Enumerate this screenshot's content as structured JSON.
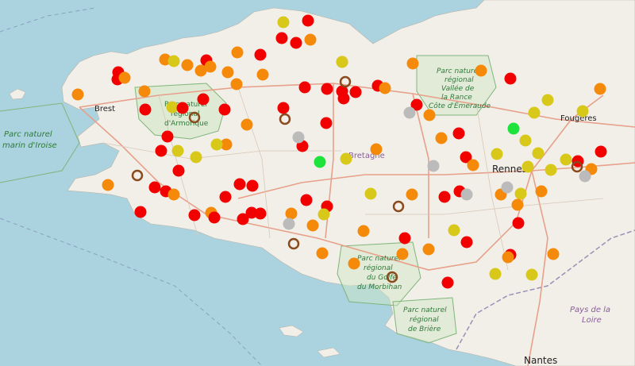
{
  "map": {
    "colors": {
      "sea": "#aad3df",
      "land": "#f2efe9",
      "land_alt": "#eae8df",
      "park": "#cfe6c3",
      "park_label": "#2f7a3a",
      "region_label": "#8a5c9e",
      "road": "#e7a08a",
      "border": "#9a8fb5",
      "city_label": "#222222",
      "marker_red": "#f20000",
      "marker_orange": "#f58a0a",
      "marker_yellow": "#d8c81a",
      "marker_grey": "#bbbbbb",
      "marker_green": "#1ee33a",
      "marker_ring": "#8a4a1c"
    },
    "labels": {
      "brest": "Brest",
      "rennes": "Rennes",
      "fougeres": "Fougères",
      "nantes": "Nantes",
      "bretagne": "Bretagne",
      "pays_de_la_loire_1": "Pays de la",
      "pays_de_la_loire_2": "Loire",
      "iroise_1": "Parc naturel",
      "iroise_2": "marin d'Iroise",
      "armorique_1": "Parc naturel",
      "armorique_2": "régional",
      "armorique_3": "d'Armorique",
      "rance_1": "Parc naturel",
      "rance_2": "régional",
      "rance_3": "Vallée de",
      "rance_4": "la Rance",
      "rance_5": "Côte d'Émeraude",
      "morbihan_1": "Parc naturel",
      "morbihan_2": "régional",
      "morbihan_3": "du Golfe",
      "morbihan_4": "du Morbihan",
      "briere_1": "Parc naturel",
      "briere_2": "régional",
      "briere_3": "de Brière"
    },
    "marker_legend": [
      "red",
      "orange",
      "yellow",
      "grey",
      "green",
      "ring"
    ]
  }
}
